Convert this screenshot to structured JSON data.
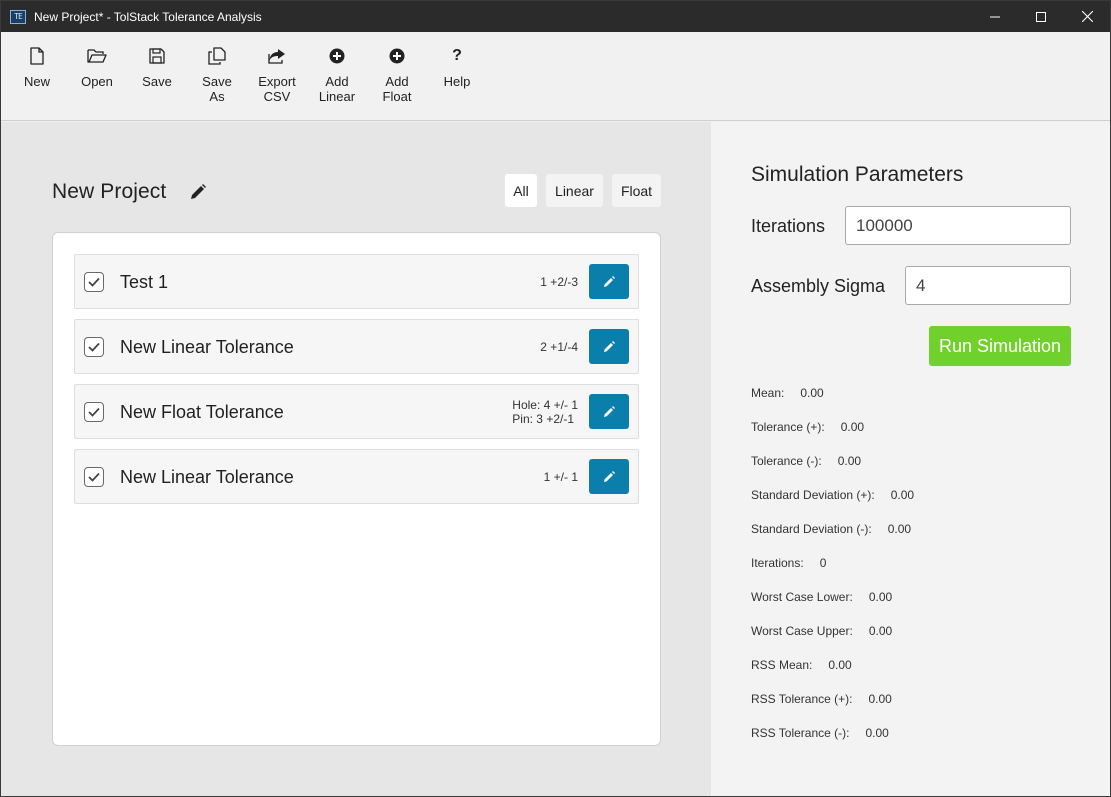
{
  "window": {
    "title": "New Project* - TolStack Tolerance Analysis",
    "app_icon_text": "TE"
  },
  "toolbar": {
    "new_label": "New",
    "open_label": "Open",
    "save_label": "Save",
    "save_as_label": "Save\nAs",
    "export_csv_label": "Export\nCSV",
    "add_linear_label": "Add\nLinear",
    "add_float_label": "Add\nFloat",
    "help_label": "Help"
  },
  "project": {
    "name": "New Project",
    "filters": {
      "all": "All",
      "linear": "Linear",
      "float": "Float",
      "selected": "All"
    },
    "tolerances": [
      {
        "name": "Test 1",
        "value": "1 +2/-3",
        "checked": true
      },
      {
        "name": "New Linear Tolerance",
        "value": "2 +1/-4",
        "checked": true
      },
      {
        "name": "New Float Tolerance",
        "value_line1": "Hole: 4 +/- 1",
        "value_line2": "Pin: 3 +2/-1",
        "checked": true
      },
      {
        "name": "New Linear Tolerance",
        "value": "1 +/- 1",
        "checked": true
      }
    ]
  },
  "simulation": {
    "title": "Simulation Parameters",
    "iterations_label": "Iterations",
    "iterations_value": "100000",
    "sigma_label": "Assembly Sigma",
    "sigma_value": "4",
    "run_label": "Run Simulation",
    "results": [
      {
        "label": "Mean:",
        "value": "0.00"
      },
      {
        "label": "Tolerance (+):",
        "value": "0.00"
      },
      {
        "label": "Tolerance (-):",
        "value": "0.00"
      },
      {
        "label": "Standard Deviation (+):",
        "value": "0.00"
      },
      {
        "label": "Standard Deviation (-):",
        "value": "0.00"
      },
      {
        "label": "Iterations:",
        "value": "0"
      },
      {
        "label": "Worst Case Lower:",
        "value": "0.00"
      },
      {
        "label": "Worst Case Upper:",
        "value": "0.00"
      },
      {
        "label": "RSS Mean:",
        "value": "0.00"
      },
      {
        "label": "RSS Tolerance (+):",
        "value": "0.00"
      },
      {
        "label": "RSS Tolerance (-):",
        "value": "0.00"
      }
    ]
  },
  "colors": {
    "titlebar": "#2b2b2b",
    "edit_button": "#0b7fab",
    "run_button": "#71d12c",
    "left_panel": "#e6e6e6",
    "right_panel": "#f3f3f3"
  }
}
